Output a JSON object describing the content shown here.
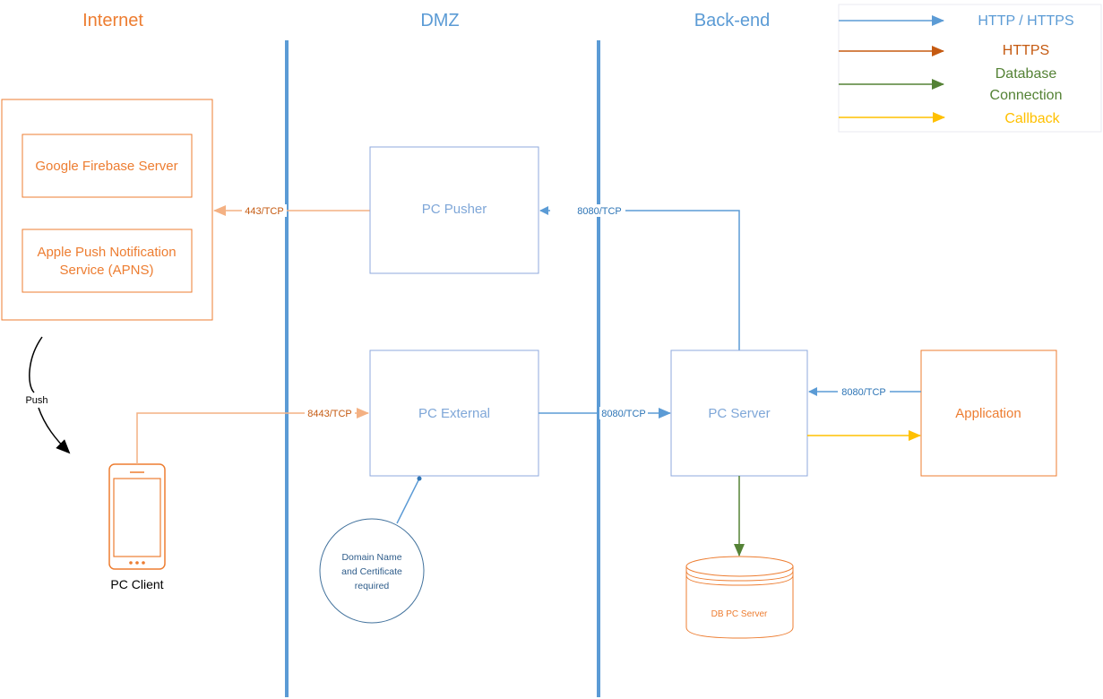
{
  "zones": {
    "internet": "Internet",
    "dmz": "DMZ",
    "backend": "Back-end"
  },
  "legend": {
    "items": [
      {
        "label": "HTTP / HTTPS",
        "color": "#5B9BD5"
      },
      {
        "label": "HTTPS",
        "color": "#C55A11"
      },
      {
        "label_line1": "Database",
        "label_line2": "Connection",
        "color": "#548235"
      },
      {
        "label": "Callback",
        "color": "#FFC000"
      }
    ]
  },
  "nodes": {
    "firebase": "Google Firebase Server",
    "apns_line1": "Apple Push Notification",
    "apns_line2": "Service (APNS)",
    "pusher": "PC Pusher",
    "external": "PC External",
    "server": "PC Server",
    "application": "Application",
    "client": "PC Client",
    "db": "DB PC Server",
    "note_line1": "Domain Name",
    "note_line2": "and Certificate",
    "note_line3": "required"
  },
  "connections": {
    "pusher_to_push_services": "443/TCP",
    "server_to_pusher": "8080/TCP",
    "client_to_external": "8443/TCP",
    "external_to_server": "8080/TCP",
    "application_to_server": "8080/TCP",
    "push": "Push"
  },
  "colors": {
    "orange": "#ED7D31",
    "light_orange": "#F4B183",
    "blue": "#5B9BD5",
    "green": "#548235",
    "yellow": "#FFC000",
    "dark_orange": "#C55A11"
  }
}
